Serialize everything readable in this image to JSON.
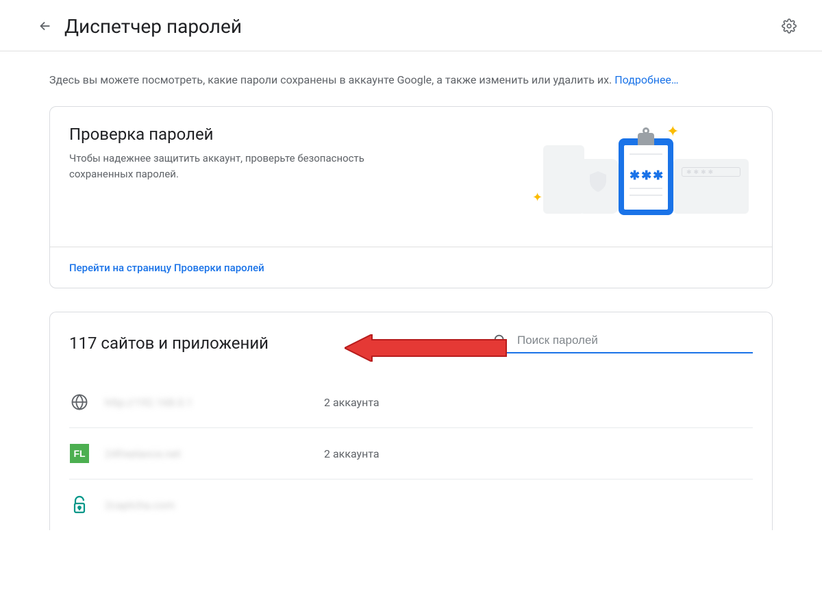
{
  "header": {
    "title": "Диспетчер паролей"
  },
  "intro": {
    "text": "Здесь вы можете посмотреть, какие пароли сохранены в аккаунте Google, а также изменить или удалить их. ",
    "link_label": "Подробнее…"
  },
  "checkup": {
    "title": "Проверка паролей",
    "desc": "Чтобы надежнее защитить аккаунт, проверьте безопасность сохраненных паролей.",
    "link_label": "Перейти на страницу Проверки паролей",
    "stars_text": "✱✱✱"
  },
  "list": {
    "title": "117 сайтов и приложений",
    "search_placeholder": "Поиск паролей",
    "rows": [
      {
        "site": "http://192.168.0.1",
        "count": "2 аккаунта",
        "icon": "globe"
      },
      {
        "site": "24freelance.net",
        "count": "2 аккаунта",
        "icon": "fl"
      },
      {
        "site": "2captcha.com",
        "count": "",
        "icon": "lock"
      }
    ]
  },
  "colors": {
    "link": "#1a73e8",
    "accent": "#1a73e8",
    "fl_green": "#4caf50",
    "lock_teal": "#009688",
    "arrow_fill": "#e53935",
    "arrow_stroke": "#b71c1c"
  }
}
